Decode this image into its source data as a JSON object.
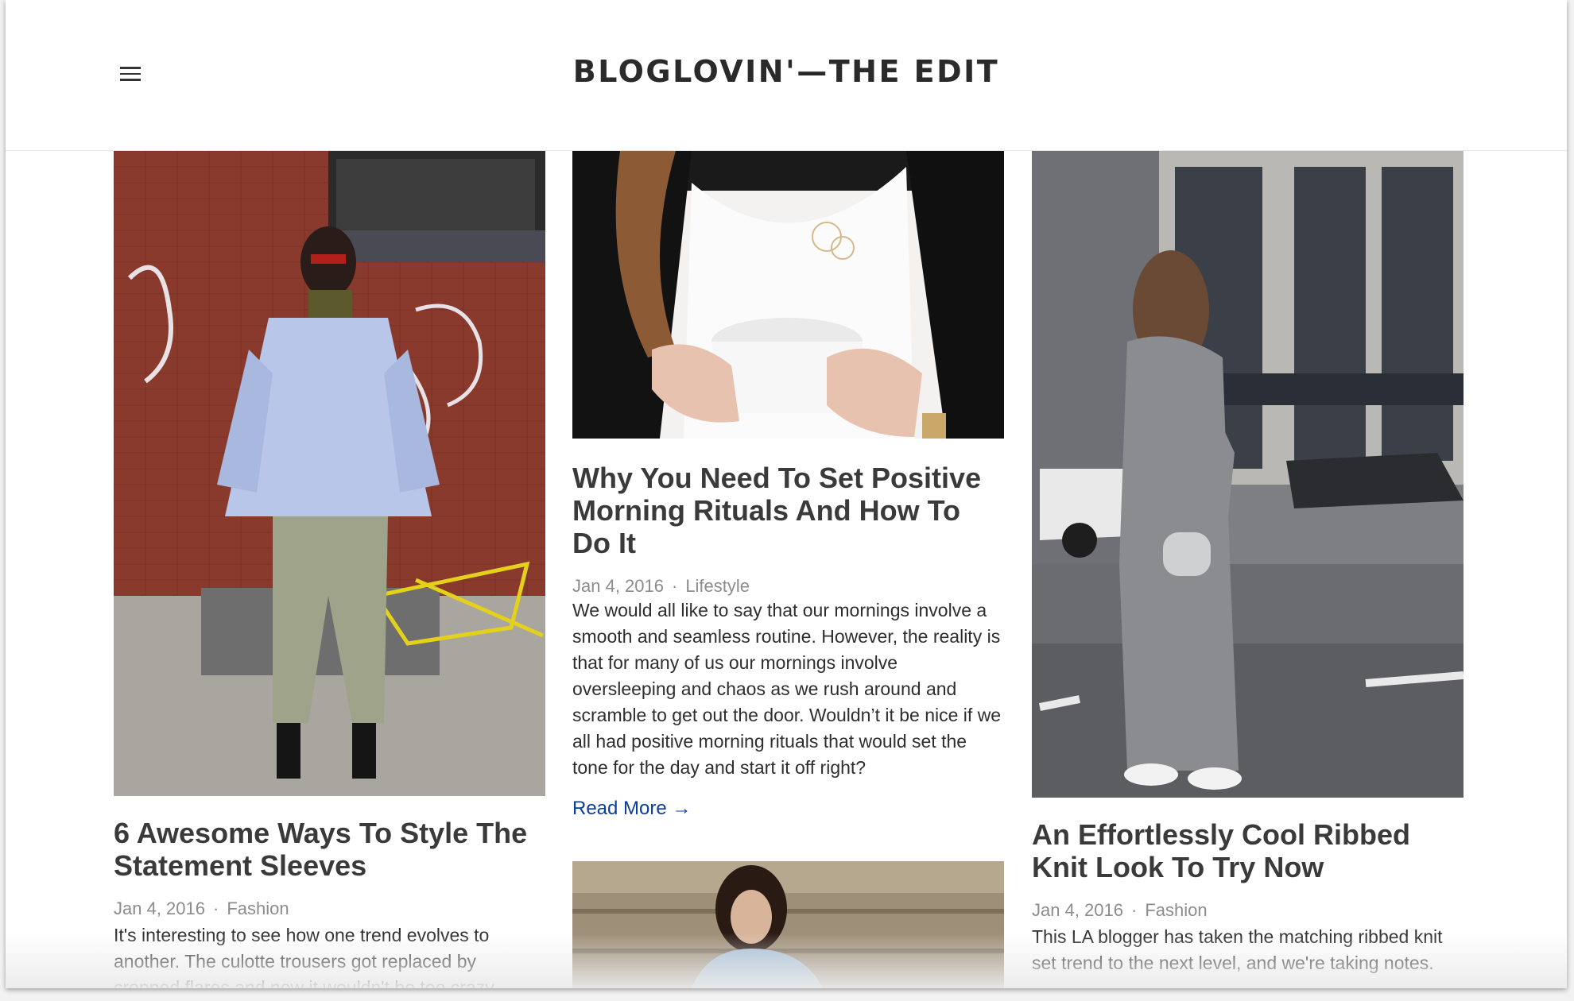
{
  "header": {
    "brand": "BLOGLOVIN'—THE EDIT",
    "menu_icon": "hamburger-menu-icon"
  },
  "posts": [
    {
      "title": "6 Awesome Ways To Style The Statement Sleeves",
      "date": "Jan 4, 2016",
      "separator": "·",
      "category": "Fashion",
      "excerpt": "It's interesting to see how one trend evolves to another. The culotte trousers got replaced by cropped flares and now it wouldn't be too crazy"
    },
    {
      "title": "Why You Need To Set Positive Morning Rituals And How To Do It",
      "date": "Jan 4, 2016",
      "separator": "·",
      "category": "Lifestyle",
      "excerpt": "We would all like to say that our mornings involve a smooth and seamless routine. However, the reality is that for many of us our mornings involve oversleeping and chaos as we rush around and scramble to get out the door. Wouldn’t it be nice if we all had positive morning rituals that would set the tone for the day and start it off right?",
      "read_more": "Read More →"
    },
    {
      "title": "An Effortlessly Cool Ribbed Knit Look To Try Now",
      "date": "Jan 4, 2016",
      "separator": "·",
      "category": "Fashion",
      "excerpt": "This LA blogger has taken the matching ribbed knit set trend to the next level, and we're taking notes."
    }
  ],
  "colors": {
    "link": "#0a3e9c",
    "title": "#3a3a3a",
    "meta": "#8c8c8c"
  }
}
